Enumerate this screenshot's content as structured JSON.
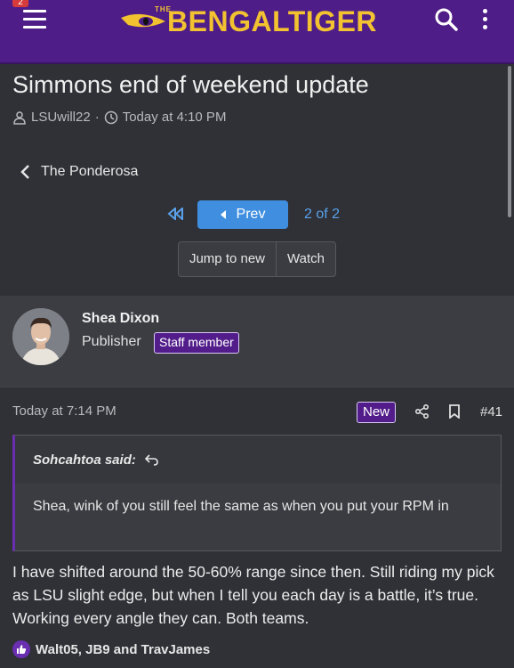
{
  "header": {
    "notification_count": "2",
    "logo_the": "THE",
    "logo_text": "BENGALTIGER"
  },
  "thread": {
    "title": "Simmons end of weekend update",
    "author": "LSUwill22",
    "separator": "·",
    "timestamp": "Today at 4:10 PM",
    "forum": "The Ponderosa"
  },
  "pagination": {
    "prev_label": "Prev",
    "page_info": "2 of 2",
    "jump_label": "Jump to new",
    "watch_label": "Watch"
  },
  "post": {
    "user_name": "Shea Dixon",
    "user_role": "Publisher",
    "staff_badge": "Staff member",
    "time": "Today at 7:14 PM",
    "new_badge": "New",
    "post_number": "#41",
    "quote_author": "Sohcahtoa said:",
    "quote_text": "Shea, wink of you still feel the same as when you put your RPM in",
    "body": "I have shifted around the 50-60% range since then. Still riding my pick as LSU slight edge, but when I tell you each day is a battle, it’s true. Working every angle they can. Both teams.",
    "reactions": "Walt05, JB9 and TravJames"
  },
  "colors": {
    "header_bg": "#4f1d87",
    "accent": "#3f8ee0",
    "badge_bg": "#521d8a",
    "logo": "#f2c230"
  }
}
